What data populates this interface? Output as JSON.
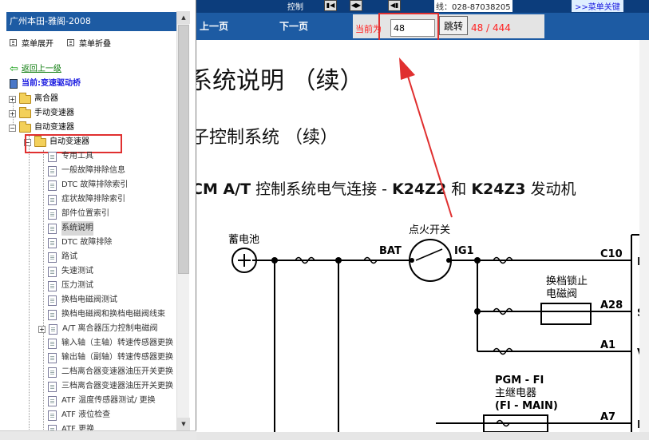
{
  "sidebar": {
    "title": "广州本田-雅阁-2008",
    "expand_all": "菜单展开",
    "collapse_all": "菜单折叠",
    "back": "返回上一级",
    "current": "当前:变速驱动桥",
    "folders": [
      "离合器",
      "手动变速器",
      "自动变速器"
    ],
    "subfolder": "自动变速器",
    "items": [
      "专用工具",
      "一般故障排除信息",
      "DTC 故障排除索引",
      "症状故障排除索引",
      "部件位置索引",
      "系统说明",
      "DTC 故障排除",
      "路试",
      "失速测试",
      "压力测试",
      "换档电磁阀测试",
      "换档电磁阀和换档电磁阀线束",
      "A/T 离合器压力控制电磁阀",
      "输入轴（主轴）转速传感器更换",
      "输出轴（副轴）转速传感器更换",
      "二档离合器变速器油压开关更换",
      "三档离合器变速器油压开关更换",
      "ATF 温度传感器测试/ 更换",
      "ATF 液位检查",
      "ATF 更换"
    ],
    "selected_item": "系统说明"
  },
  "toolbar": {
    "prev": "上一页",
    "next": "下一页",
    "current_label": "当前为",
    "page_value": "48",
    "jump": "跳转",
    "page_count": "48 / 444",
    "strip_left": "控制",
    "strip_mid": "线：028-87038205",
    "strip_right": ">>菜单关键"
  },
  "document": {
    "heading1": "系统说明 （续）",
    "heading2": "子控制系统 （续）",
    "heading3_prefix": "CM A/T",
    "heading3_mid": " 控制系统电气连接 - ",
    "heading3_code1": "K24Z2",
    "heading3_and": " 和 ",
    "heading3_code2": "K24Z3",
    "heading3_suffix": " 发动机"
  },
  "diagram": {
    "battery": "蓄电池",
    "ignition_switch": "点火开关",
    "bat": "BAT",
    "ig1": "IG1",
    "shift_lock": "换档锁止",
    "solenoid": "电磁阀",
    "pgm_fi": "PGM - FI",
    "main_relay": "主继电器",
    "fi_main": "(FI - MAIN)",
    "pins": [
      "C10",
      "A28",
      "A1",
      "A7"
    ],
    "pin_ends": [
      "IG",
      "SI",
      "VI",
      "M"
    ]
  },
  "colors": {
    "title_bar": "#1d5ba3",
    "highlight": "#e03030",
    "link_green": "#0a7a0a",
    "current_blue": "#1a1ae0"
  }
}
